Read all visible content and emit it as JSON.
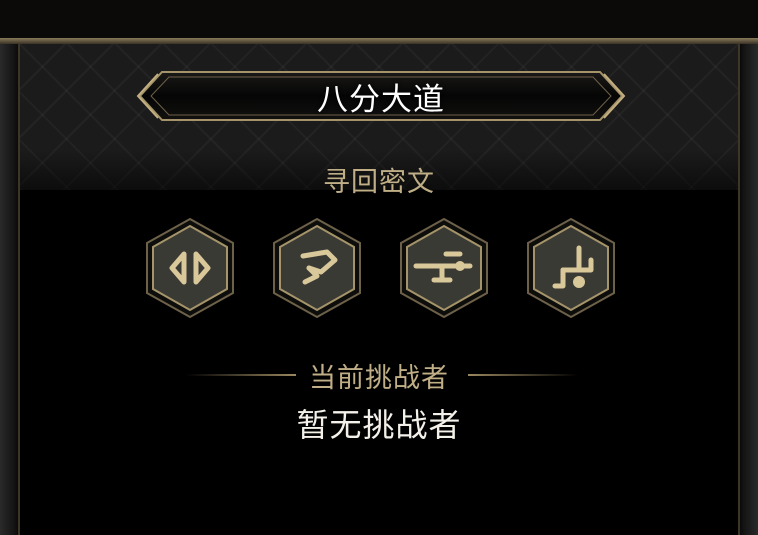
{
  "header": {
    "title": "八分大道"
  },
  "cipher": {
    "label": "寻回密文",
    "glyphs": [
      {
        "icon": "split-diamond-rune-icon"
      },
      {
        "icon": "pennant-rune-icon"
      },
      {
        "icon": "cross-bar-rune-icon"
      },
      {
        "icon": "hook-circle-rune-icon"
      }
    ]
  },
  "challenger": {
    "section_label": "当前挑战者",
    "value": "暂无挑战者"
  },
  "colors": {
    "gold": "#bfae86",
    "badge_fill": "#3a3a35",
    "badge_border": "#8c7d5c",
    "rune": "#d9c89a",
    "title": "#ffffff"
  }
}
